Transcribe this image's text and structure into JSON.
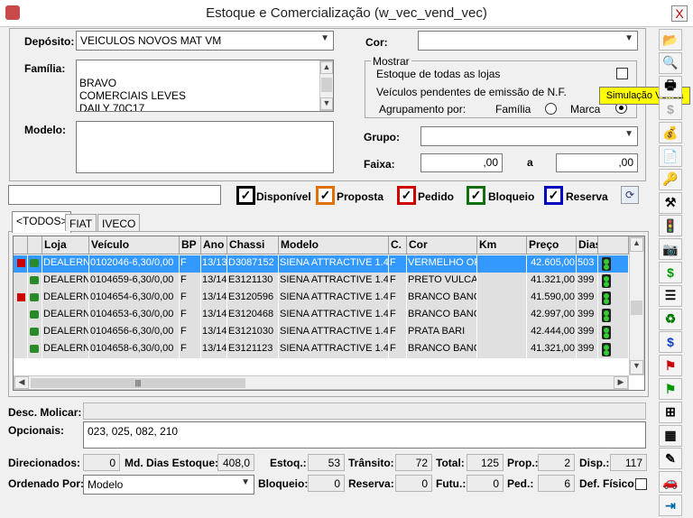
{
  "window": {
    "title": "Estoque e Comercialização (w_vec_vend_vec)",
    "close": "X"
  },
  "filters": {
    "deposito_label": "Depósito:",
    "deposito_value": "VEICULOS NOVOS MAT VM",
    "familia_label": "Família:",
    "familia_items": [
      "BRAVO",
      "COMERCIAIS LEVES",
      "DAILY 70C17"
    ],
    "modelo_label": "Modelo:",
    "cor_label": "Cor:",
    "cor_value": "",
    "mostrar_label": "Mostrar",
    "estoque_todas_label": "Estoque de todas as lojas",
    "pendentes_label": "Veículos pendentes de emissão de N.F.",
    "agrupamento_label": "Agrupamento por:",
    "familia_radio_label": "Família",
    "marca_radio_label": "Marca",
    "grupo_label": "Grupo:",
    "grupo_value": "",
    "faixa_label": "Faixa:",
    "faixa_de": ",00",
    "faixa_a_label": "a",
    "faixa_ate": ",00"
  },
  "status_filters": {
    "search_value": "",
    "items": [
      {
        "label": "Disponível",
        "color": "#000000",
        "checked": true
      },
      {
        "label": "Proposta",
        "color": "#e07000",
        "checked": true
      },
      {
        "label": "Pedido",
        "color": "#d00000",
        "checked": true
      },
      {
        "label": "Bloqueio",
        "color": "#107010",
        "checked": true
      },
      {
        "label": "Reserva",
        "color": "#0000c0",
        "checked": true
      }
    ]
  },
  "tabs": [
    "<TODOS>",
    "FIAT",
    "IVECO"
  ],
  "grid": {
    "columns": [
      "Loja",
      "Veículo",
      "BP",
      "Ano",
      "Chassi",
      "Modelo",
      "C.",
      "Cor",
      "Km",
      "Preço",
      "Dias"
    ],
    "rows": [
      {
        "loja": "DEALERNE",
        "veiculo": "0102046-6,30/0,00",
        "bp": "F",
        "ano": "13/13",
        "chassi": "D3087152",
        "modelo": "SIENA ATTRACTIVE 1.4 F",
        "c": "F",
        "cor": "VERMELHO OPF",
        "km": "",
        "preco": "42.605,00",
        "dias": "503",
        "flag": true,
        "selected": true
      },
      {
        "loja": "DEALERNE",
        "veiculo": "0104659-6,30/0,00",
        "bp": "F",
        "ano": "13/14",
        "chassi": "E3121130",
        "modelo": "SIENA ATTRACTIVE 1.4 F",
        "c": "F",
        "cor": "PRETO VULCAN",
        "km": "",
        "preco": "41.321,00",
        "dias": "399",
        "flag": false,
        "selected": false
      },
      {
        "loja": "DEALERNE",
        "veiculo": "0104654-6,30/0,00",
        "bp": "F",
        "ano": "13/14",
        "chassi": "E3120596",
        "modelo": "SIENA ATTRACTIVE 1.4 F",
        "c": "F",
        "cor": "BRANCO BANCI",
        "km": "",
        "preco": "41.590,00",
        "dias": "399",
        "flag": true,
        "selected": false
      },
      {
        "loja": "DEALERNE",
        "veiculo": "0104653-6,30/0,00",
        "bp": "F",
        "ano": "13/14",
        "chassi": "E3120468",
        "modelo": "SIENA ATTRACTIVE 1.4 F",
        "c": "F",
        "cor": "BRANCO BANCI",
        "km": "",
        "preco": "42.997,00",
        "dias": "399",
        "flag": false,
        "selected": false
      },
      {
        "loja": "DEALERNE",
        "veiculo": "0104656-6,30/0,00",
        "bp": "F",
        "ano": "13/14",
        "chassi": "E3121030",
        "modelo": "SIENA ATTRACTIVE 1.4 F",
        "c": "F",
        "cor": "PRATA BARI",
        "km": "",
        "preco": "42.444,00",
        "dias": "399",
        "flag": false,
        "selected": false
      },
      {
        "loja": "DEALERNE",
        "veiculo": "0104658-6,30/0,00",
        "bp": "F",
        "ano": "13/14",
        "chassi": "E3121123",
        "modelo": "SIENA ATTRACTIVE 1.4 F",
        "c": "F",
        "cor": "BRANCO BANCI",
        "km": "",
        "preco": "41.321,00",
        "dias": "399",
        "flag": false,
        "selected": false
      }
    ]
  },
  "details": {
    "desc_molicar_label": "Desc. Molicar:",
    "desc_molicar_value": "",
    "opcionais_label": "Opcionais:",
    "opcionais_value": "023, 025, 082, 210"
  },
  "totals": {
    "direcionados_label": "Direcionados:",
    "direcionados": "0",
    "md_dias_label": "Md. Dias Estoque:",
    "md_dias": "408,0",
    "estoq_label": "Estoq.:",
    "estoq": "53",
    "transito_label": "Trânsito:",
    "transito": "72",
    "total_label": "Total:",
    "total": "125",
    "prop_label": "Prop.:",
    "prop": "2",
    "disp_label": "Disp.:",
    "disp": "117",
    "ordenado_label": "Ordenado Por:",
    "ordenado_value": "Modelo",
    "bloqueio_label": "Bloqueio:",
    "bloqueio": "0",
    "reserva_label": "Reserva:",
    "reserva": "0",
    "futu_label": "Futu.:",
    "futu": "0",
    "ped_label": "Ped.:",
    "ped": "6",
    "def_fisico_label": "Def. Físico:"
  },
  "tooltip": "Simulação Venda",
  "toolbar_icons": [
    "open-folder-icon",
    "search-document-icon",
    "print-icon",
    "dollar-icon",
    "money-bag-icon",
    "document-icon",
    "key-icon",
    "tools-icon",
    "traffic-light-icon",
    "camera-icon",
    "green-dollar-icon",
    "list-icon",
    "refresh-icon",
    "dollar-down-icon",
    "red-flag-icon",
    "green-flag-icon",
    "table-link-icon",
    "grid-icon",
    "edit-icon",
    "car-icon",
    "exit-icon"
  ]
}
